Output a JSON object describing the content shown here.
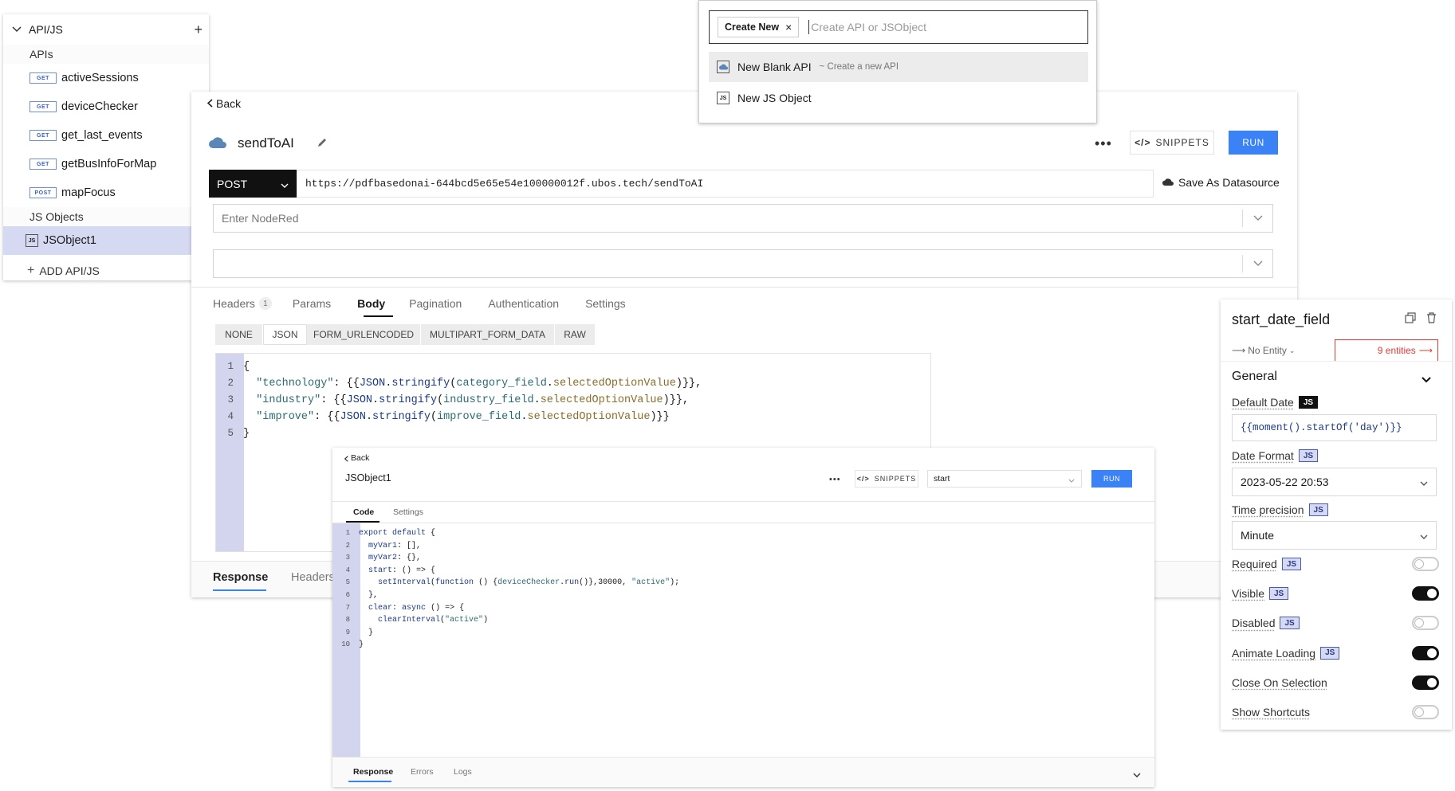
{
  "sidebar": {
    "title": "API/JS",
    "apis_section": "APIs",
    "apis": [
      {
        "method": "GET",
        "name": "activeSessions"
      },
      {
        "method": "GET",
        "name": "deviceChecker"
      },
      {
        "method": "GET",
        "name": "get_last_events"
      },
      {
        "method": "GET",
        "name": "getBusInfoForMap"
      },
      {
        "method": "POST",
        "name": "mapFocus"
      }
    ],
    "js_section": "JS Objects",
    "js_objects": [
      {
        "badge": "JS",
        "name": "JSObject1"
      }
    ],
    "add_label": "ADD API/JS"
  },
  "popup": {
    "chip": "Create New",
    "placeholder": "Create API or JSObject",
    "options": [
      {
        "label": "New Blank API",
        "hint": "~ Create a new API"
      },
      {
        "label": "New JS Object",
        "hint": ""
      }
    ]
  },
  "api": {
    "back": "Back",
    "name": "sendToAI",
    "snippets": "SNIPPETS",
    "run": "RUN",
    "method": "POST",
    "url": "https://pdfbasedonai-644bcd5e65e54e100000012f.ubos.tech/sendToAI",
    "save_datasource": "Save As Datasource",
    "datasource_placeholder": "Enter NodeRed",
    "tabs": [
      "Headers",
      "Params",
      "Body",
      "Pagination",
      "Authentication",
      "Settings"
    ],
    "headers_count": "1",
    "body_types": [
      "NONE",
      "JSON",
      "FORM_URLENCODED",
      "MULTIPART_FORM_DATA",
      "RAW"
    ],
    "code": [
      "{",
      "  \"technology\": {{JSON.stringify(category_field.selectedOptionValue)}},",
      "  \"industry\": {{JSON.stringify(industry_field.selectedOptionValue)}},",
      "  \"improve\": {{JSON.stringify(improve_field.selectedOptionValue)}}",
      "}"
    ],
    "response_tabs": [
      "Response",
      "Headers"
    ]
  },
  "jsobj": {
    "back": "Back",
    "name": "JSObject1",
    "snippets": "SNIPPETS",
    "function_select": "start",
    "run": "RUN",
    "tabs": [
      "Code",
      "Settings"
    ],
    "code": [
      "export default {",
      "  myVar1: [],",
      "  myVar2: {},",
      "  start: () => {",
      "    setInterval(function () {deviceChecker.run()},30000, \"active\");",
      "  },",
      "  clear: async () => {",
      "    clearInterval(\"active\")",
      "  }",
      "}"
    ],
    "response_tabs": [
      "Response",
      "Errors",
      "Logs"
    ]
  },
  "props": {
    "widget_name": "start_date_field",
    "entity": "No Entity",
    "entities": "9 entities",
    "section": "General",
    "default_date_label": "Default Date",
    "default_date_value": "{{moment().startOf('day')}}",
    "date_format_label": "Date Format",
    "date_format_value": "2023-05-22 20:53",
    "time_precision_label": "Time precision",
    "time_precision_value": "Minute",
    "toggles": [
      {
        "label": "Required",
        "js": true,
        "on": false
      },
      {
        "label": "Visible",
        "js": true,
        "on": true
      },
      {
        "label": "Disabled",
        "js": true,
        "on": false
      },
      {
        "label": "Animate Loading",
        "js": true,
        "on": true
      },
      {
        "label": "Close On Selection",
        "js": false,
        "on": true
      },
      {
        "label": "Show Shortcuts",
        "js": false,
        "on": false
      }
    ],
    "js_label": "JS"
  },
  "colors": {
    "accent": "#3b82f6",
    "selected": "#d6d9f2",
    "danger": "#e53935"
  }
}
